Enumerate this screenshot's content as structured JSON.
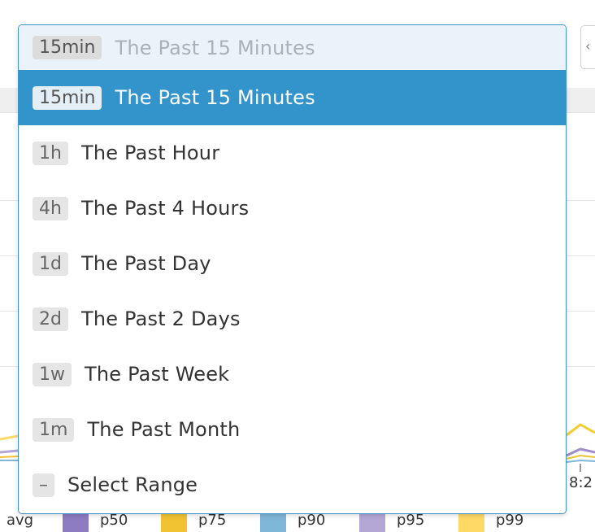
{
  "time_picker": {
    "current": {
      "badge": "15min",
      "label": "The Past 15 Minutes"
    },
    "options": [
      {
        "badge": "15min",
        "label": "The Past 15 Minutes",
        "highlighted": true
      },
      {
        "badge": "1h",
        "label": "The Past Hour"
      },
      {
        "badge": "4h",
        "label": "The Past 4 Hours"
      },
      {
        "badge": "1d",
        "label": "The Past Day"
      },
      {
        "badge": "2d",
        "label": "The Past 2 Days"
      },
      {
        "badge": "1w",
        "label": "The Past Week"
      },
      {
        "badge": "1m",
        "label": "The Past Month"
      },
      {
        "badge": "–",
        "label": "Select Range"
      }
    ]
  },
  "chart": {
    "x_tick_partial": "8:2",
    "legend": [
      {
        "label": "avg",
        "color": "#ffffff"
      },
      {
        "label": "p50",
        "color": "#8e7cc3"
      },
      {
        "label": "p75",
        "color": "#f1c232"
      },
      {
        "label": "p90",
        "color": "#7fb7d9"
      },
      {
        "label": "p95",
        "color": "#b4a7d6"
      },
      {
        "label": "p99",
        "color": "#ffd966"
      }
    ]
  },
  "colors": {
    "accent": "#3394cb",
    "dropdown_border": "#3d95cb",
    "selected_bg": "#eaf3fa"
  }
}
